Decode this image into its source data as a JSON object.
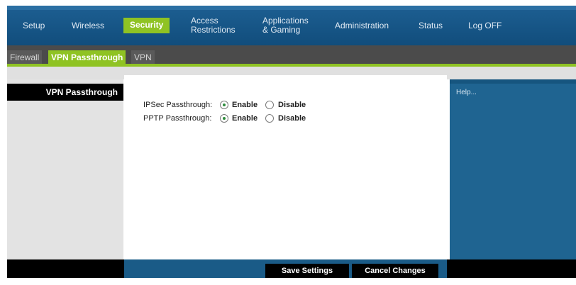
{
  "topnav": {
    "items": [
      {
        "label": "Setup"
      },
      {
        "label": "Wireless"
      },
      {
        "label": "Security"
      },
      {
        "label": "Access\nRestrictions"
      },
      {
        "label": "Applications\n& Gaming"
      },
      {
        "label": "Administration"
      },
      {
        "label": "Status"
      },
      {
        "label": "Log OFF"
      }
    ],
    "active": "Security"
  },
  "subtabs": {
    "items": [
      {
        "label": "Firewall"
      },
      {
        "label": "VPN Passthrough"
      },
      {
        "label": "VPN"
      }
    ],
    "active": "VPN Passthrough"
  },
  "sidebar": {
    "title": "VPN Passthrough"
  },
  "form": {
    "ipsec": {
      "label": "IPSec Passthrough:",
      "enable": "Enable",
      "disable": "Disable",
      "selected": "Enable"
    },
    "pptp": {
      "label": "PPTP Passthrough:",
      "enable": "Enable",
      "disable": "Disable",
      "selected": "Enable"
    }
  },
  "help": {
    "label": "Help..."
  },
  "actions": {
    "save": "Save Settings",
    "cancel": "Cancel Changes"
  },
  "colors": {
    "nav_blue": "#1d5f92",
    "accent_green": "#8fc323",
    "help_blue": "#1f6491"
  }
}
